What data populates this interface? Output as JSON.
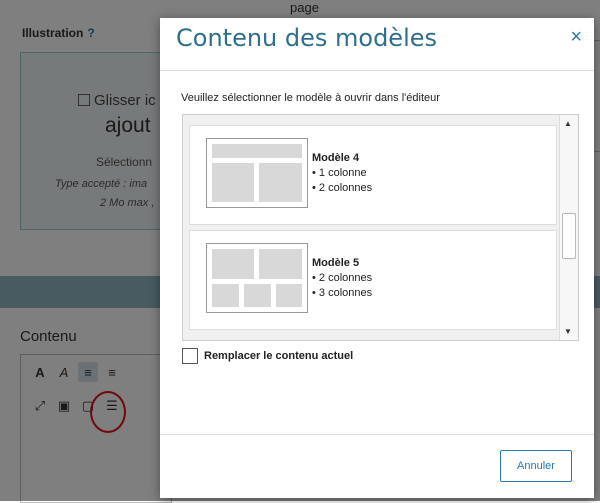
{
  "background": {
    "top_label": "page",
    "illustration_label": "Illustration",
    "illustration_help": "?",
    "dropzone_line1": "Glisser ic",
    "dropzone_line2": "ajout",
    "dropzone_select": "Sélectionn",
    "dropzone_type": "Type accepté : ima",
    "dropzone_size": "2 Mo max ,",
    "contenu_label": "Contenu",
    "toolbar_row1": [
      "A",
      "A",
      "≡",
      "≡"
    ],
    "toolbar_row2": [
      "⤢",
      "▣",
      "▢",
      "☰"
    ]
  },
  "modal": {
    "title": "Contenu des modèles",
    "close": "×",
    "instruction": "Veuillez sélectionner le modèle à ouvrir dans l'éditeur",
    "templates": [
      {
        "name": "Modèle 4",
        "features": [
          "• 1 colonne",
          "• 2 colonnes"
        ]
      },
      {
        "name": "Modèle 5",
        "features": [
          "• 2 colonnes",
          "• 3 colonnes"
        ]
      }
    ],
    "replace_label": "Remplacer le contenu actuel",
    "cancel_label": "Annuler"
  }
}
